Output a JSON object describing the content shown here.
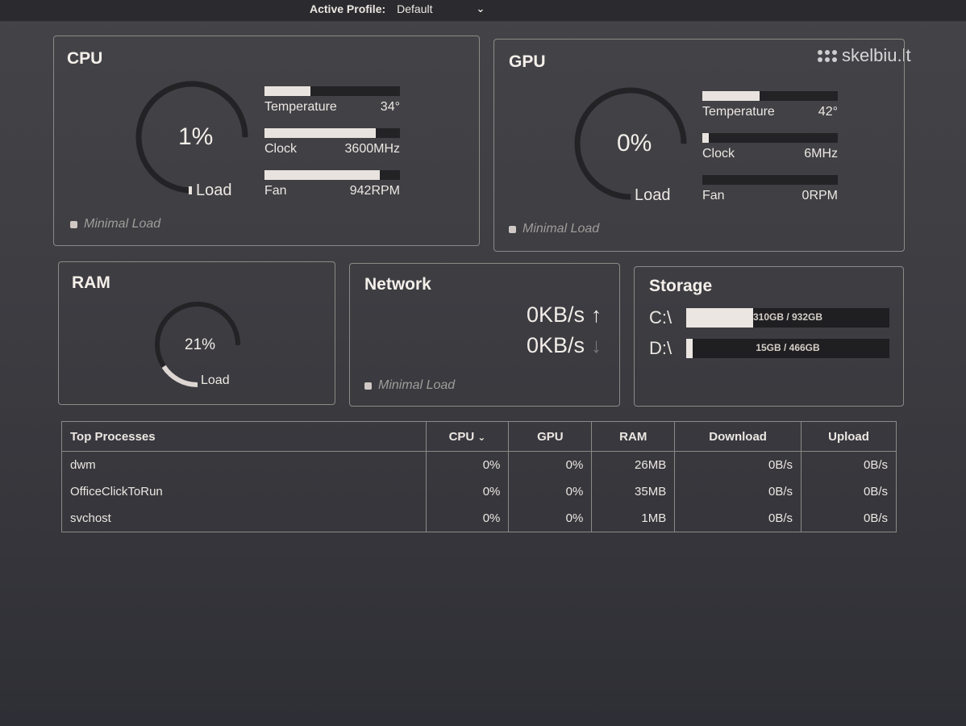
{
  "header": {
    "profile_label": "Active Profile:",
    "profile_value": "Default"
  },
  "watermark": "skelbiu.lt",
  "cpu": {
    "title": "CPU",
    "load_value": "1%",
    "load_label": "Load",
    "load_fraction": 0.01,
    "stats": [
      {
        "label": "Temperature",
        "value": "34°",
        "fill": 0.34
      },
      {
        "label": "Clock",
        "value": "3600MHz",
        "fill": 0.82
      },
      {
        "label": "Fan",
        "value": "942RPM",
        "fill": 0.85
      }
    ],
    "status": "Minimal Load"
  },
  "gpu": {
    "title": "GPU",
    "load_value": "0%",
    "load_label": "Load",
    "load_fraction": 0.0,
    "stats": [
      {
        "label": "Temperature",
        "value": "42°",
        "fill": 0.42
      },
      {
        "label": "Clock",
        "value": "6MHz",
        "fill": 0.05
      },
      {
        "label": "Fan",
        "value": "0RPM",
        "fill": 0.0
      }
    ],
    "status": "Minimal Load"
  },
  "ram": {
    "title": "RAM",
    "load_value": "21%",
    "load_label": "Load",
    "load_fraction": 0.21
  },
  "network": {
    "title": "Network",
    "upload": "0KB/s",
    "download": "0KB/s",
    "status": "Minimal Load"
  },
  "storage": {
    "title": "Storage",
    "drives": [
      {
        "name": "C:\\",
        "usage": "310GB / 932GB",
        "fill": 0.33
      },
      {
        "name": "D:\\",
        "usage": "15GB / 466GB",
        "fill": 0.03
      }
    ]
  },
  "processes": {
    "columns": [
      "Top Processes",
      "CPU",
      "GPU",
      "RAM",
      "Download",
      "Upload"
    ],
    "rows": [
      [
        "dwm",
        "0%",
        "0%",
        "26MB",
        "0B/s",
        "0B/s"
      ],
      [
        "OfficeClickToRun",
        "0%",
        "0%",
        "35MB",
        "0B/s",
        "0B/s"
      ],
      [
        "svchost",
        "0%",
        "0%",
        "1MB",
        "0B/s",
        "0B/s"
      ]
    ]
  },
  "colors": {
    "accent": "#e9e3df",
    "track": "#232326",
    "panel_border": "#8c8a86"
  }
}
